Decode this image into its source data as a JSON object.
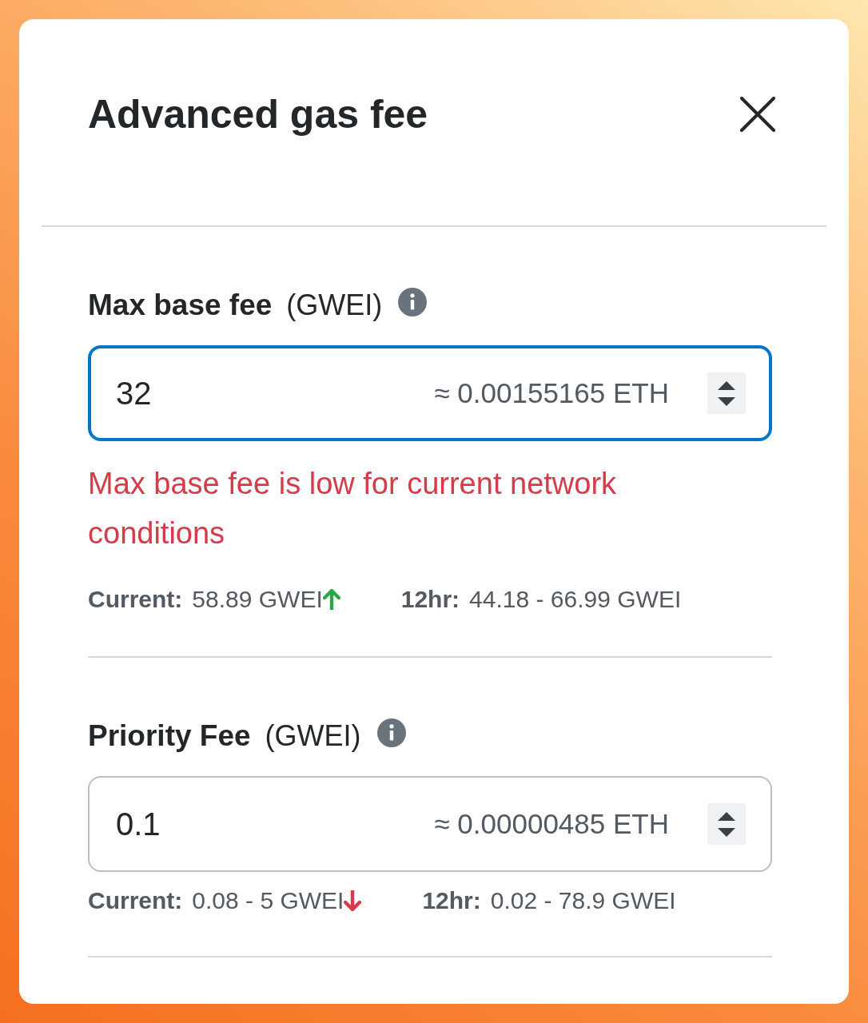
{
  "dialog": {
    "title": "Advanced gas fee"
  },
  "fields": [
    {
      "label": "Max base fee",
      "unit": "(GWEI)",
      "value": "32",
      "conversion": "≈ 0.00155165 ETH",
      "focused": true,
      "error": "Max base fee is low for current network conditions",
      "stats": [
        {
          "kind": "rising",
          "label": "Current:",
          "value": "58.89 GWEI"
        },
        {
          "kind": "range",
          "label": "12hr:",
          "value": "44.18 - 66.99 GWEI"
        }
      ]
    },
    {
      "label": "Priority Fee",
      "unit": "(GWEI)",
      "value": "0.1",
      "conversion": "≈ 0.00000485 ETH",
      "focused": false,
      "stats": [
        {
          "kind": "falling",
          "label": "Current:",
          "value": "0.08 - 5 GWEI"
        },
        {
          "kind": "range",
          "label": "12hr:",
          "value": "0.02 - 78.9 GWEI"
        }
      ]
    }
  ]
}
